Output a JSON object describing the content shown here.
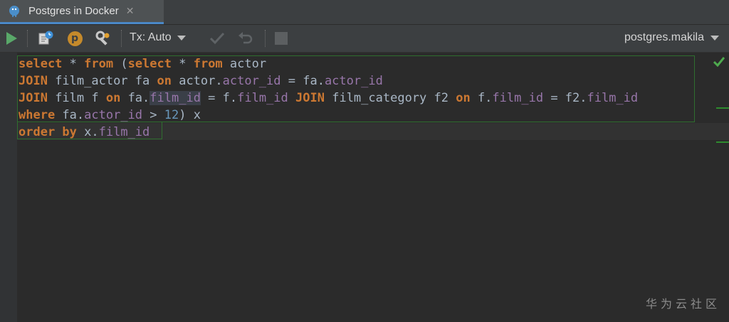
{
  "tab": {
    "title": "Postgres in Docker",
    "close_glyph": "✕",
    "icon": "postgres-elephant-icon"
  },
  "toolbar": {
    "run_icon": "run-icon",
    "console_icon": "console-history-icon",
    "p_icon_label": "p",
    "settings_icon": "settings-icon",
    "tx_label": "Tx: Auto",
    "commit_icon": "commit-icon",
    "rollback_icon": "rollback-icon",
    "stop_icon": "stop-icon",
    "connection": "postgres.makila"
  },
  "editor": {
    "lines": [
      [
        {
          "t": "select",
          "c": "kw"
        },
        {
          "t": " * ",
          "c": ""
        },
        {
          "t": "from",
          "c": "kw"
        },
        {
          "t": " (",
          "c": ""
        },
        {
          "t": "select",
          "c": "kw"
        },
        {
          "t": " * ",
          "c": ""
        },
        {
          "t": "from",
          "c": "kw"
        },
        {
          "t": " actor",
          "c": ""
        }
      ],
      [
        {
          "t": "JOIN",
          "c": "kw"
        },
        {
          "t": " film_actor fa ",
          "c": ""
        },
        {
          "t": "on",
          "c": "kw"
        },
        {
          "t": " actor.",
          "c": ""
        },
        {
          "t": "actor_id",
          "c": "fld"
        },
        {
          "t": " = fa.",
          "c": ""
        },
        {
          "t": "actor_id",
          "c": "fld"
        }
      ],
      [
        {
          "t": "JOIN",
          "c": "kw"
        },
        {
          "t": " film f ",
          "c": ""
        },
        {
          "t": "on",
          "c": "kw"
        },
        {
          "t": " fa.",
          "c": ""
        },
        {
          "t": "film_id",
          "c": "fld hl"
        },
        {
          "t": " = f.",
          "c": ""
        },
        {
          "t": "film_id",
          "c": "fld"
        },
        {
          "t": " ",
          "c": ""
        },
        {
          "t": "JOIN",
          "c": "kw"
        },
        {
          "t": " film_category f2 ",
          "c": ""
        },
        {
          "t": "on",
          "c": "kw"
        },
        {
          "t": " f.",
          "c": ""
        },
        {
          "t": "film_id",
          "c": "fld"
        },
        {
          "t": " = f2.",
          "c": ""
        },
        {
          "t": "film_id",
          "c": "fld"
        }
      ],
      [
        {
          "t": "where",
          "c": "kw"
        },
        {
          "t": " fa.",
          "c": ""
        },
        {
          "t": "actor_id",
          "c": "fld"
        },
        {
          "t": " > ",
          "c": ""
        },
        {
          "t": "12",
          "c": "num"
        },
        {
          "t": ") x",
          "c": ""
        }
      ],
      [
        {
          "t": "order by",
          "c": "kw"
        },
        {
          "t": " x.",
          "c": ""
        },
        {
          "t": "film_id",
          "c": "fld"
        }
      ]
    ],
    "status_icon": "check-icon"
  },
  "watermark": "华为云社区",
  "colors": {
    "keyword": "#cc7832",
    "field": "#9876aa",
    "number": "#6897bb",
    "text": "#a9b7c6",
    "run_green": "#59a869"
  }
}
